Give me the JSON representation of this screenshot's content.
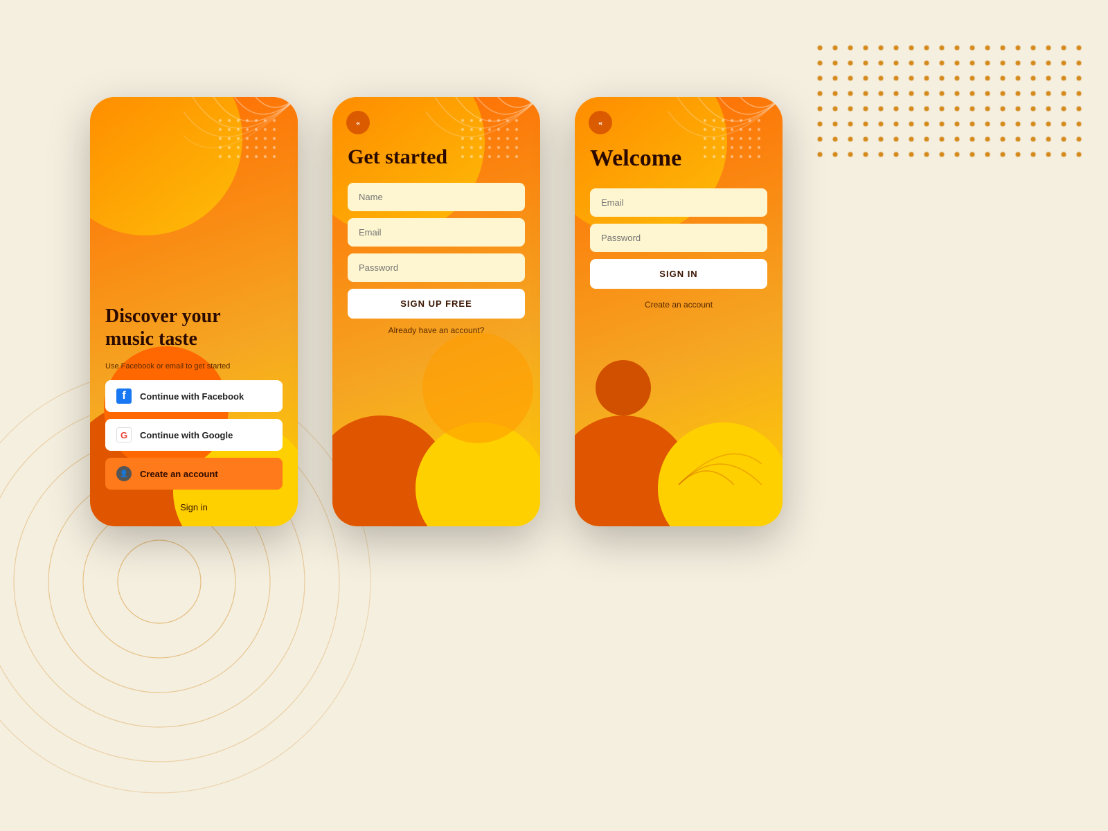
{
  "background": {
    "color": "#f5efe0"
  },
  "card1": {
    "title": "Discover your\nmusic taste",
    "subtitle": "Use Facebook or email to get started",
    "facebook_btn": "Continue with Facebook",
    "google_btn": "Continue with Google",
    "create_btn": "Create an account",
    "signin_link": "Sign in"
  },
  "card2": {
    "title": "Get started",
    "name_placeholder": "Name",
    "email_placeholder": "Email",
    "password_placeholder": "Password",
    "signup_btn": "SIGN UP FREE",
    "already_link": "Already have an account?"
  },
  "card3": {
    "title": "Welcome",
    "email_placeholder": "Email",
    "password_placeholder": "Password",
    "signin_btn": "SIGN IN",
    "create_link": "Create an account"
  },
  "icons": {
    "back": "«",
    "facebook": "f",
    "google": "G",
    "person": "👤"
  }
}
